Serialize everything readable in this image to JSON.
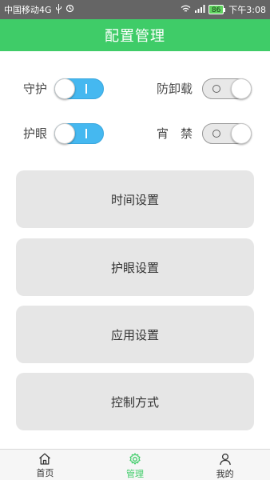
{
  "status_bar": {
    "carrier": "中国移动4G",
    "battery": "86",
    "time": "下午3:08"
  },
  "app_bar": {
    "title": "配置管理"
  },
  "toggles": [
    {
      "label": "守护",
      "state": "on"
    },
    {
      "label": "防卸载",
      "state": "off"
    },
    {
      "label": "护眼",
      "state": "on"
    },
    {
      "label": "宵　禁",
      "state": "off"
    }
  ],
  "menu": {
    "time_settings": "时间设置",
    "eye_settings": "护眼设置",
    "app_settings": "应用设置",
    "control_mode": "控制方式"
  },
  "bottom_nav": [
    {
      "label": "首页",
      "icon": "home-icon",
      "active": false
    },
    {
      "label": "管理",
      "icon": "gear-icon",
      "active": true
    },
    {
      "label": "我的",
      "icon": "person-icon",
      "active": false
    }
  ],
  "colors": {
    "accent": "#3fcc68",
    "switch_on": "#45b8f0",
    "status_bar": "#656565"
  }
}
